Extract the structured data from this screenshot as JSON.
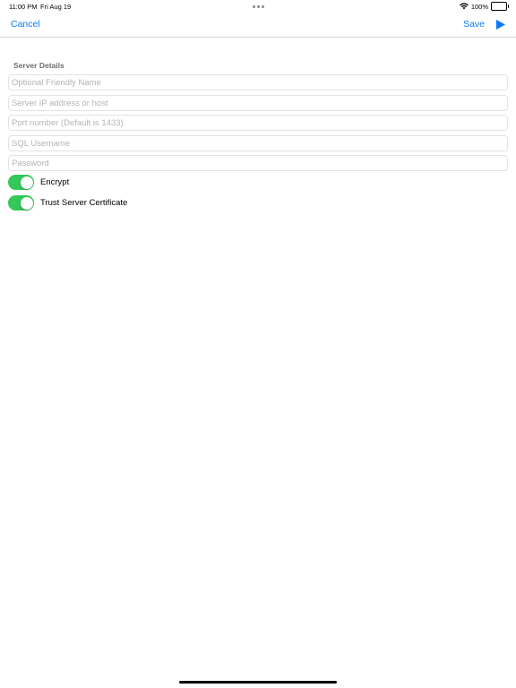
{
  "status_bar": {
    "time": "11:00 PM",
    "date": "Fri Aug 19",
    "battery": "100%",
    "wifi_icon": "wifi-icon",
    "battery_icon": "battery-icon"
  },
  "nav": {
    "cancel_label": "Cancel",
    "save_label": "Save",
    "play_icon": "play-icon",
    "accent_color": "#0a7aff"
  },
  "form": {
    "section_title": "Server Details",
    "fields": [
      {
        "name": "friendly-name-field",
        "placeholder": "Optional Friendly Name",
        "value": ""
      },
      {
        "name": "server-host-field",
        "placeholder": "Server IP address or host",
        "value": ""
      },
      {
        "name": "port-field",
        "placeholder": "Port number (Default is 1433)",
        "value": ""
      },
      {
        "name": "username-field",
        "placeholder": "SQL Username",
        "value": ""
      },
      {
        "name": "password-field",
        "placeholder": "Password",
        "value": ""
      }
    ],
    "toggles": [
      {
        "label": "Encrypt",
        "on": true
      },
      {
        "label": "Trust Server Certificate",
        "on": true
      }
    ],
    "toggle_on_color": "#34c759"
  }
}
